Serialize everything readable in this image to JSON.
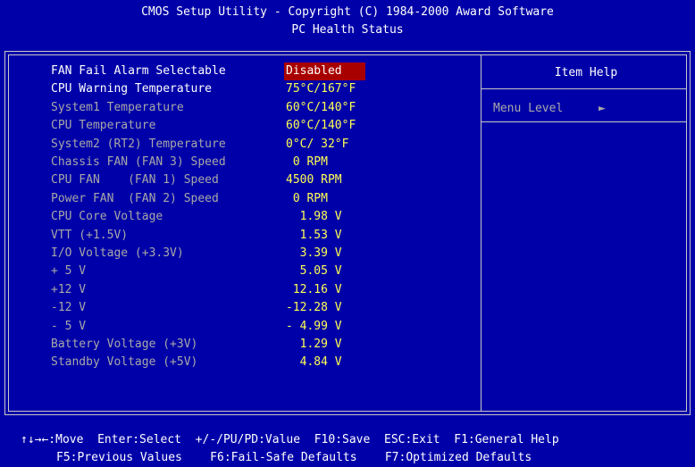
{
  "header": {
    "title": "CMOS Setup Utility - Copyright (C) 1984-2000 Award Software",
    "subtitle": "PC Health Status"
  },
  "items": [
    {
      "label": "FAN Fail Alarm Selectable",
      "value": "Disabled",
      "selected": true,
      "editable": true
    },
    {
      "label": "CPU Warning Temperature",
      "value": "75°C/167°F",
      "editable": true
    },
    {
      "label": "System1 Temperature",
      "value": "60°C/140°F"
    },
    {
      "label": "CPU Temperature",
      "value": "60°C/140°F"
    },
    {
      "label": "System2 (RT2) Temperature",
      "value": "0°C/ 32°F"
    },
    {
      "label": "Chassis FAN (FAN 3) Speed",
      "value": " 0 RPM"
    },
    {
      "label": "CPU FAN    (FAN 1) Speed",
      "value": "4500 RPM"
    },
    {
      "label": "Power FAN  (FAN 2) Speed",
      "value": " 0 RPM"
    },
    {
      "label": "CPU Core Voltage",
      "value": "  1.98 V"
    },
    {
      "label": "VTT (+1.5V)",
      "value": "  1.53 V"
    },
    {
      "label": "I/O Voltage (+3.3V)",
      "value": "  3.39 V"
    },
    {
      "label": "+ 5 V",
      "value": "  5.05 V"
    },
    {
      "label": "+12 V",
      "value": " 12.16 V"
    },
    {
      "label": "-12 V",
      "value": "-12.28 V"
    },
    {
      "label": "- 5 V",
      "value": "- 4.99 V"
    },
    {
      "label": "Battery Voltage (+3V)",
      "value": "  1.29 V"
    },
    {
      "label": "Standby Voltage (+5V)",
      "value": "  4.84 V"
    }
  ],
  "help": {
    "title": "Item Help",
    "menu_level": "Menu Level",
    "arrow": "►"
  },
  "footer": {
    "line1": "↑↓→←:Move  Enter:Select  +/-/PU/PD:Value  F10:Save  ESC:Exit  F1:General Help",
    "line2": "F5:Previous Values    F6:Fail-Safe Defaults    F7:Optimized Defaults"
  },
  "colors": {
    "background": "#0000a8",
    "label_gray": "#a8a8a8",
    "value_yellow": "#ffff54",
    "selected_bg": "#a80000",
    "white": "#ffffff"
  }
}
